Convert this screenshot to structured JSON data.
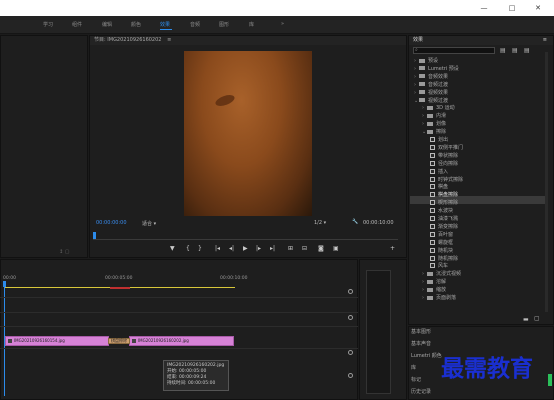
{
  "window": {
    "minimize": "—",
    "maximize": "□",
    "close": "✕"
  },
  "workspaces": {
    "tabs": [
      "学习",
      "组件",
      "编辑",
      "颜色",
      "效果",
      "音频",
      "图形",
      "库"
    ],
    "active_index": 4,
    "more": "»"
  },
  "program_monitor": {
    "title": "节目: IMG20210926160202",
    "menu": "≡",
    "timecode_current": "00:00:00:00",
    "fit": "适合",
    "fraction": "1/2",
    "timecode_duration": "00:00:10:00"
  },
  "effects": {
    "title": "效果",
    "menu": "≡",
    "search_placeholder": "",
    "items": [
      {
        "label": "预设",
        "type": "folder",
        "level": 0
      },
      {
        "label": "Lumetri 预设",
        "type": "folder",
        "level": 0
      },
      {
        "label": "音频效果",
        "type": "folder",
        "level": 0
      },
      {
        "label": "音频过渡",
        "type": "folder",
        "level": 0
      },
      {
        "label": "视频效果",
        "type": "folder",
        "level": 0
      },
      {
        "label": "视频过渡",
        "type": "folder",
        "level": 0,
        "open": true
      },
      {
        "label": "3D 运动",
        "type": "folder",
        "level": 1
      },
      {
        "label": "内滑",
        "type": "folder",
        "level": 1
      },
      {
        "label": "划像",
        "type": "folder",
        "level": 1
      },
      {
        "label": "擦除",
        "type": "folder",
        "level": 1,
        "open": true
      },
      {
        "label": "划出",
        "type": "fx",
        "level": 2
      },
      {
        "label": "双侧平推门",
        "type": "fx",
        "level": 2
      },
      {
        "label": "带状擦除",
        "type": "fx",
        "level": 2
      },
      {
        "label": "径向擦除",
        "type": "fx",
        "level": 2
      },
      {
        "label": "插入",
        "type": "fx",
        "level": 2
      },
      {
        "label": "时钟式擦除",
        "type": "fx",
        "level": 2
      },
      {
        "label": "棋盘",
        "type": "fx",
        "level": 2
      },
      {
        "label": "棋盘擦除",
        "type": "fx",
        "level": 2,
        "selected": true
      },
      {
        "label": "楔形擦除",
        "type": "fx",
        "level": 2
      },
      {
        "label": "水波块",
        "type": "fx",
        "level": 2
      },
      {
        "label": "油漆飞溅",
        "type": "fx",
        "level": 2
      },
      {
        "label": "渐变擦除",
        "type": "fx",
        "level": 2
      },
      {
        "label": "百叶窗",
        "type": "fx",
        "level": 2
      },
      {
        "label": "螺旋框",
        "type": "fx",
        "level": 2
      },
      {
        "label": "随机块",
        "type": "fx",
        "level": 2
      },
      {
        "label": "随机擦除",
        "type": "fx",
        "level": 2
      },
      {
        "label": "风车",
        "type": "fx",
        "level": 2
      },
      {
        "label": "沉浸式视频",
        "type": "folder",
        "level": 1
      },
      {
        "label": "溶解",
        "type": "folder",
        "level": 1
      },
      {
        "label": "缩放",
        "type": "folder",
        "level": 1
      },
      {
        "label": "页面剥落",
        "type": "folder",
        "level": 1
      }
    ]
  },
  "lower_panels": [
    "基本图形",
    "基本声音",
    "Lumetri 颜色",
    "库",
    "标记",
    "历史记录"
  ],
  "timeline": {
    "ruler": [
      "00:00",
      "00:00:05:00",
      "00:00:10:00"
    ],
    "clip1": "IMG20210926160154.jpg",
    "transition": "棋盘擦除",
    "clip2": "IMG20210926160202.jpg",
    "tooltip": {
      "name": "IMG20210926160202.jpg",
      "start": "开始: 00:00:05:00",
      "end": "结束: 00:00:09:24",
      "duration": "持续时间: 00:00:05:00"
    }
  },
  "watermark": "最需教育",
  "colors": {
    "accent": "#2d8ceb",
    "clip": "#d682d6",
    "watermark": "#1a2fd0"
  }
}
